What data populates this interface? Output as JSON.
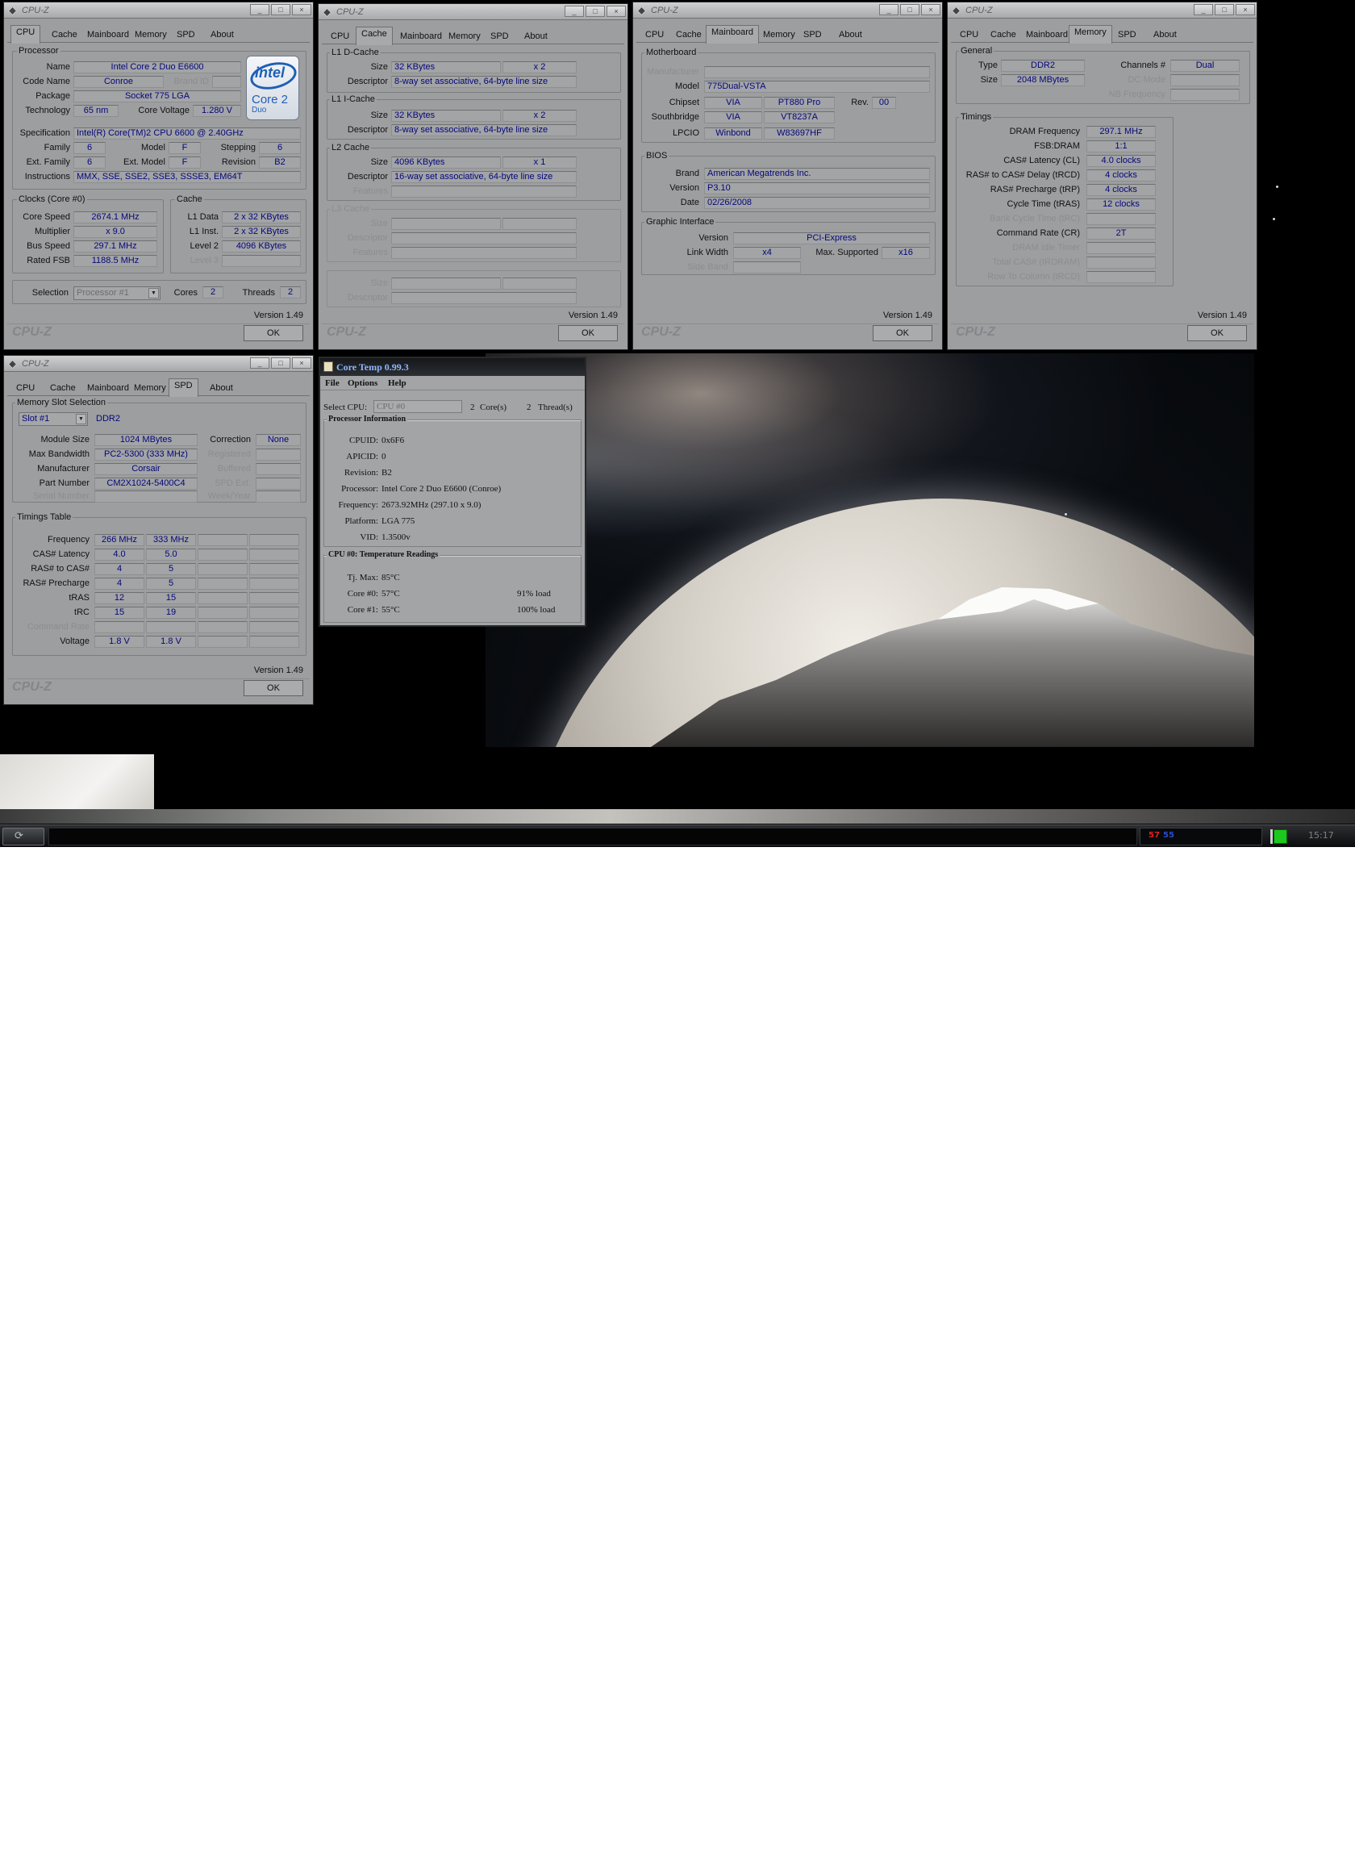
{
  "cpu_window": {
    "title": "CPU-Z",
    "tabs": [
      "CPU",
      "Cache",
      "Mainboard",
      "Memory",
      "SPD",
      "About"
    ],
    "selected_tab": "CPU",
    "processor_group": "Processor",
    "rows": {
      "name_label": "Name",
      "name": "Intel Core 2 Duo E6600",
      "code_label": "Code Name",
      "code": "Conroe",
      "brand_id_label": "Brand ID",
      "package_label": "Package",
      "package": "Socket 775 LGA",
      "tech_label": "Technology",
      "tech": "65 nm",
      "volt_label": "Core Voltage",
      "volt": "1.280 V",
      "spec_label": "Specification",
      "spec": "Intel(R) Core(TM)2 CPU          6600  @ 2.40GHz",
      "family_label": "Family",
      "family": "6",
      "model_label": "Model",
      "model": "F",
      "stepping_label": "Stepping",
      "stepping": "6",
      "extfam_label": "Ext. Family",
      "extfam": "6",
      "extmodel_label": "Ext. Model",
      "extmodel": "F",
      "rev_label": "Revision",
      "rev": "B2",
      "instr_label": "Instructions",
      "instr": "MMX, SSE, SSE2, SSE3, SSSE3, EM64T"
    },
    "clocks_group": "Clocks (Core #0)",
    "clocks": {
      "core_label": "Core Speed",
      "core": "2674.1 MHz",
      "mult_label": "Multiplier",
      "mult": "x 9.0",
      "bus_label": "Bus Speed",
      "bus": "297.1 MHz",
      "fsb_label": "Rated FSB",
      "fsb": "1188.5 MHz"
    },
    "cache_group": "Cache",
    "cache": {
      "l1d_label": "L1 Data",
      "l1d": "2 x 32 KBytes",
      "l1i_label": "L1 Inst.",
      "l1i": "2 x 32 KBytes",
      "l2_label": "Level 2",
      "l2": "4096 KBytes",
      "l3_label": "Level 3"
    },
    "selection_label": "Selection",
    "selection": "Processor #1",
    "cores_label": "Cores",
    "cores": "2",
    "threads_label": "Threads",
    "threads": "2",
    "logo": {
      "word": "intel",
      "line2": "Core 2",
      "line3": "Duo"
    },
    "version": "Version 1.49",
    "ok": "OK",
    "brand": "CPU-Z"
  },
  "cache_window": {
    "title": "CPU-Z",
    "tabs": [
      "CPU",
      "Cache",
      "Mainboard",
      "Memory",
      "SPD",
      "About"
    ],
    "l1d_group": "L1 D-Cache",
    "l1d_size_label": "Size",
    "l1d_size": "32 KBytes",
    "l1d_count": "x 2",
    "l1d_desc_label": "Descriptor",
    "l1d_desc": "8-way set associative, 64-byte line size",
    "l1i_group": "L1 I-Cache",
    "l1i_size_label": "Size",
    "l1i_size": "32 KBytes",
    "l1i_count": "x 2",
    "l1i_desc_label": "Descriptor",
    "l1i_desc": "8-way set associative, 64-byte line size",
    "l2_group": "L2 Cache",
    "l2_size_label": "Size",
    "l2_size": "4096 KBytes",
    "l2_count": "x 1",
    "l2_desc_label": "Descriptor",
    "l2_desc": "16-way set associative, 64-byte line size",
    "l2_feat_label": "Features",
    "l3_group": "L3 Cache",
    "l3_size_label": "Size",
    "l3_desc_label": "Descriptor",
    "l3_feat_label": "Features",
    "x_size_label": "Size",
    "x_desc_label": "Descriptor",
    "version": "Version 1.49",
    "ok": "OK",
    "brand": "CPU-Z"
  },
  "mainboard_window": {
    "title": "CPU-Z",
    "tabs": [
      "CPU",
      "Cache",
      "Mainboard",
      "Memory",
      "SPD",
      "About"
    ],
    "mb_group": "Motherboard",
    "manu_label": "Manufacturer",
    "model_label": "Model",
    "model": "775Dual-VSTA",
    "chipset_label": "Chipset",
    "chipset": "VIA",
    "chipset2": "PT880 Pro",
    "rev_label": "Rev.",
    "rev": "00",
    "sb_label": "Southbridge",
    "sb": "VIA",
    "sb2": "VT8237A",
    "lpcio_label": "LPCIO",
    "lpcio": "Winbond",
    "lpcio2": "W83697HF",
    "bios_group": "BIOS",
    "brand_label": "Brand",
    "brand": "American Megatrends Inc.",
    "ver_label": "Version",
    "ver": "P3.10",
    "date_label": "Date",
    "date": "02/26/2008",
    "gi_group": "Graphic Interface",
    "gi_ver_label": "Version",
    "gi_ver": "PCI-Express",
    "lw_label": "Link Width",
    "lw": "x4",
    "max_label": "Max. Supported",
    "max": "x16",
    "sb_band_label": "Side Band",
    "version": "Version 1.49",
    "ok": "OK",
    "brand_mark": "CPU-Z"
  },
  "memory_window": {
    "title": "CPU-Z",
    "tabs": [
      "CPU",
      "Cache",
      "Mainboard",
      "Memory",
      "SPD",
      "About"
    ],
    "general_group": "General",
    "type_label": "Type",
    "type": "DDR2",
    "channels_label": "Channels #",
    "channels": "Dual",
    "size_label": "Size",
    "size": "2048 MBytes",
    "dc_label": "DC Mode",
    "nb_label": "NB Frequency",
    "timings_group": "Timings",
    "t": {
      "dram_label": "DRAM Frequency",
      "dram": "297.1 MHz",
      "fsb_label": "FSB:DRAM",
      "fsb": "1:1",
      "cl_label": "CAS# Latency (CL)",
      "cl": "4.0 clocks",
      "rcd_label": "RAS# to CAS# Delay (tRCD)",
      "rcd": "4 clocks",
      "rp_label": "RAS# Precharge (tRP)",
      "rp": "4 clocks",
      "ras_label": "Cycle Time (tRAS)",
      "ras": "12 clocks",
      "bank_label": "Bank Cycle Time (tRC)",
      "cr_label": "Command Rate (CR)",
      "cr": "2T",
      "idle_label": "DRAM Idle Timer",
      "trdram_label": "Total CAS# (tRDRAM)",
      "trcd2_label": "Row To Column (tRCD)"
    },
    "version": "Version 1.49",
    "ok": "OK",
    "brand": "CPU-Z"
  },
  "spd_window": {
    "title": "CPU-Z",
    "tabs": [
      "CPU",
      "Cache",
      "Mainboard",
      "Memory",
      "SPD",
      "About"
    ],
    "slot_group": "Memory Slot Selection",
    "slot": "Slot #1",
    "slot_type": "DDR2",
    "ms_label": "Module Size",
    "ms": "1024 MBytes",
    "corr_label": "Correction",
    "corr": "None",
    "bw_label": "Max Bandwidth",
    "bw": "PC2-5300 (333 MHz)",
    "reg_label": "Registered",
    "manu_label": "Manufacturer",
    "manu": "Corsair",
    "buf_label": "Buffered",
    "part_label": "Part Number",
    "part": "CM2X1024-5400C4",
    "spd_ext_label": "SPD Ext.",
    "serial_label": "Serial Number",
    "week_label": "Week/Year",
    "timings_group": "Timings Table",
    "rows": [
      {
        "label": "Frequency",
        "a": "266 MHz",
        "b": "333 MHz"
      },
      {
        "label": "CAS# Latency",
        "a": "4.0",
        "b": "5.0"
      },
      {
        "label": "RAS# to CAS#",
        "a": "4",
        "b": "5"
      },
      {
        "label": "RAS# Precharge",
        "a": "4",
        "b": "5"
      },
      {
        "label": "tRAS",
        "a": "12",
        "b": "15"
      },
      {
        "label": "tRC",
        "a": "15",
        "b": "19"
      },
      {
        "label": "Command Rate",
        "a": "",
        "b": ""
      },
      {
        "label": "Voltage",
        "a": "1.8 V",
        "b": "1.8 V"
      }
    ],
    "version": "Version 1.49",
    "ok": "OK",
    "brand": "CPU-Z"
  },
  "core_temp": {
    "title": "Core Temp 0.99.3",
    "menu": [
      "File",
      "Options",
      "Help"
    ],
    "select_label": "Select CPU:",
    "select": "CPU #0",
    "cores": "2",
    "cores_label": "Core(s)",
    "threads": "2",
    "threads_label": "Thread(s)",
    "info_group": "Processor Information",
    "info": [
      {
        "label": "CPUID:",
        "value": "0x6F6"
      },
      {
        "label": "APICID:",
        "value": "0"
      },
      {
        "label": "Revision:",
        "value": "B2"
      },
      {
        "label": "Processor:",
        "value": "Intel Core 2 Duo E6600 (Conroe)"
      },
      {
        "label": "Frequency:",
        "value": "2673.92MHz (297.10 x 9.0)"
      },
      {
        "label": "Platform:",
        "value": "LGA 775"
      },
      {
        "label": "VID:",
        "value": "1.3500v"
      }
    ],
    "temp_group": "CPU #0: Temperature Readings",
    "tj_label": "Tj. Max:",
    "tj": "85°C",
    "core0_label": "Core #0:",
    "core0": "57°C",
    "core0_load": "91% load",
    "core1_label": "Core #1:",
    "core1": "55°C",
    "core1_load": "100% load"
  },
  "taskbar": {
    "tray_t1": "57",
    "tray_t2": "55",
    "clock": "15:17"
  }
}
